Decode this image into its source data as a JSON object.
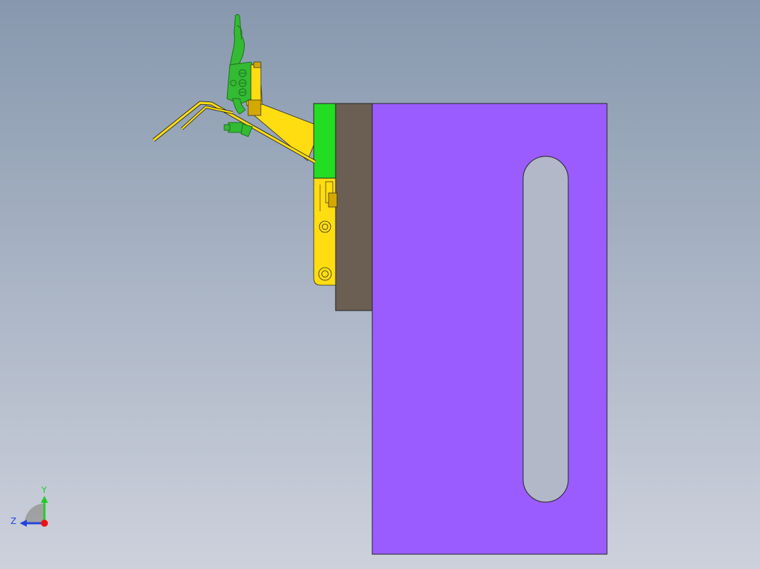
{
  "background": {
    "top_color": "#8798ae",
    "bottom_color": "#cdd1dc"
  },
  "colors": {
    "base_plate": "#9a5cff",
    "spacer_plate": "#6b5e53",
    "green_block": "#22dd22",
    "bracket": "#ffdd11",
    "bracket_dark": "#d4a800",
    "clamp_green": "#33bb33",
    "clamp_dark": "#1e6e1e",
    "slot_fill": "#b2b8c8",
    "outline": "#222222",
    "triad_y": "#22cc22",
    "triad_z": "#2244dd",
    "triad_origin": "#ee1111",
    "triad_arc": "#999999"
  },
  "triad": {
    "y_label": "Y",
    "z_label": "Z"
  }
}
